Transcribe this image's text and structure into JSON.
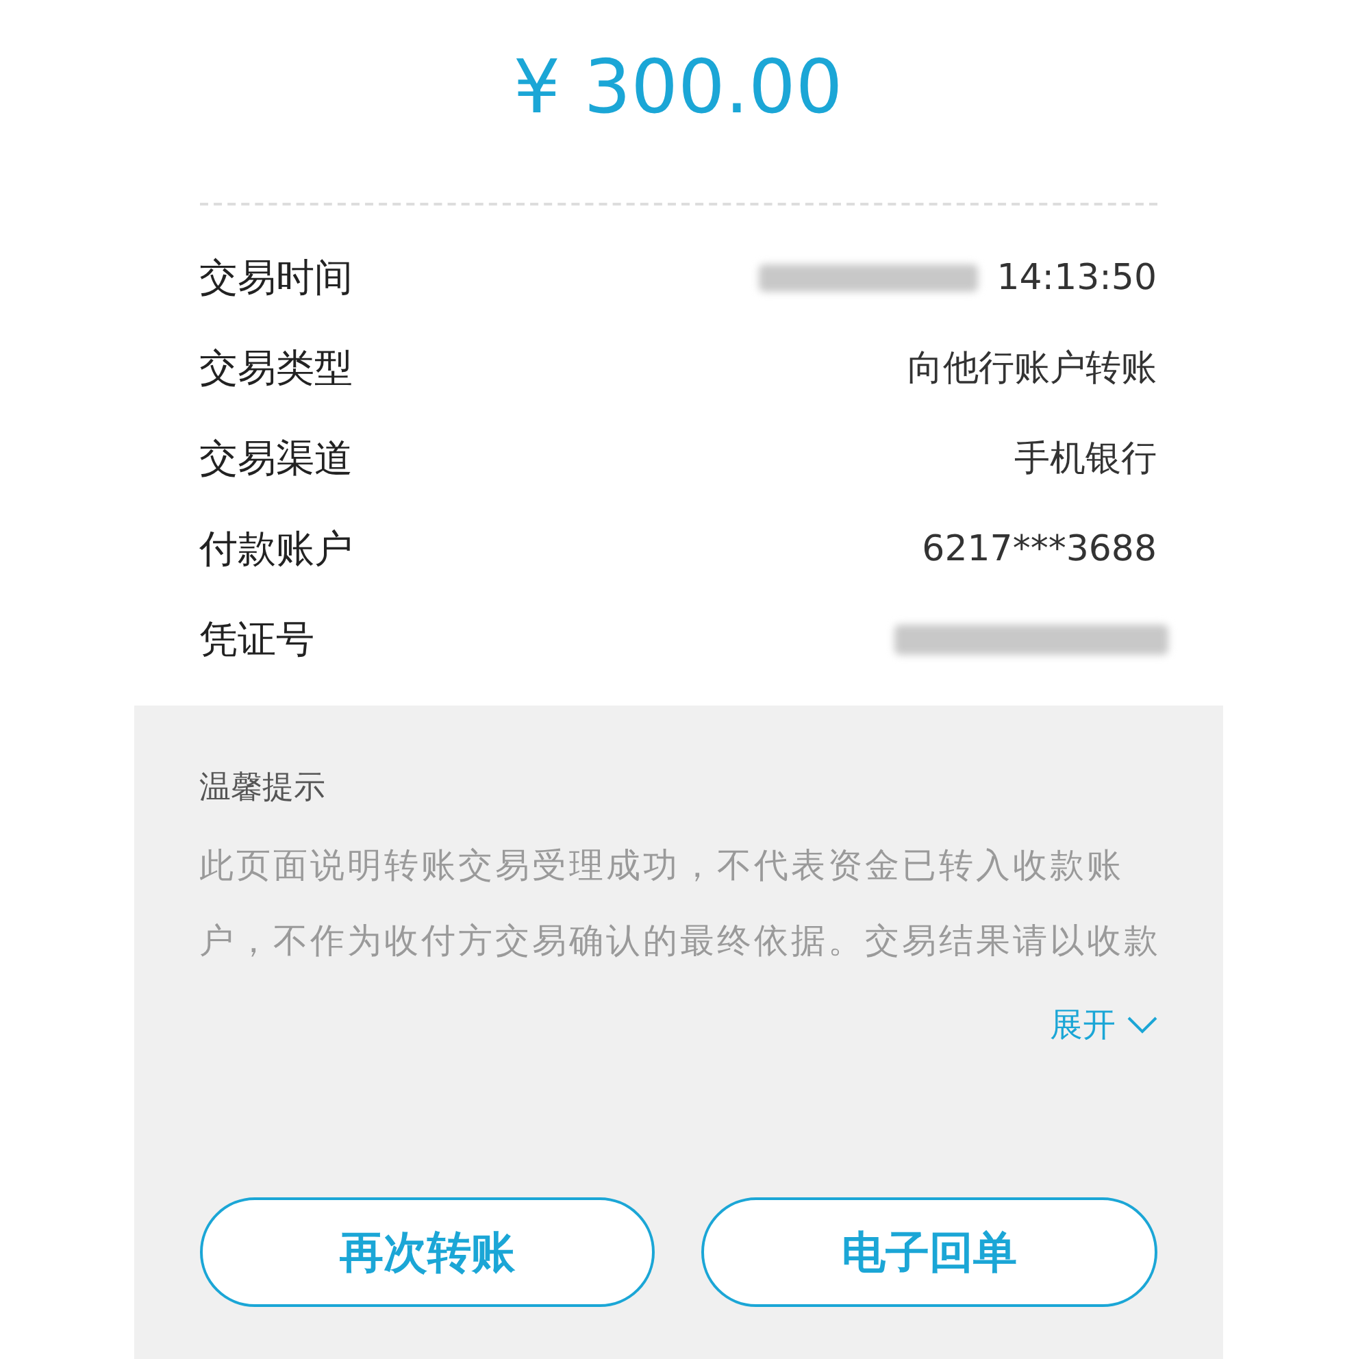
{
  "amount": "¥ 300.00",
  "details": [
    {
      "label": "交易时间",
      "value": "14:13:50",
      "redacted": true
    },
    {
      "label": "交易类型",
      "value": "向他行账户转账",
      "redacted": false
    },
    {
      "label": "交易渠道",
      "value": "手机银行",
      "redacted": false
    },
    {
      "label": "付款账户",
      "value": "6217***3688",
      "redacted": false
    },
    {
      "label": "凭证号",
      "redacted": true
    }
  ],
  "notice": {
    "title": "温馨提示",
    "text": "此页面说明转账交易受理成功，不代表资金已转入收款账户，不作为收付方交易确认的最终依据。交易结果请以收款",
    "expand": "展开"
  },
  "buttons": [
    "再次转账",
    "电子回单"
  ]
}
